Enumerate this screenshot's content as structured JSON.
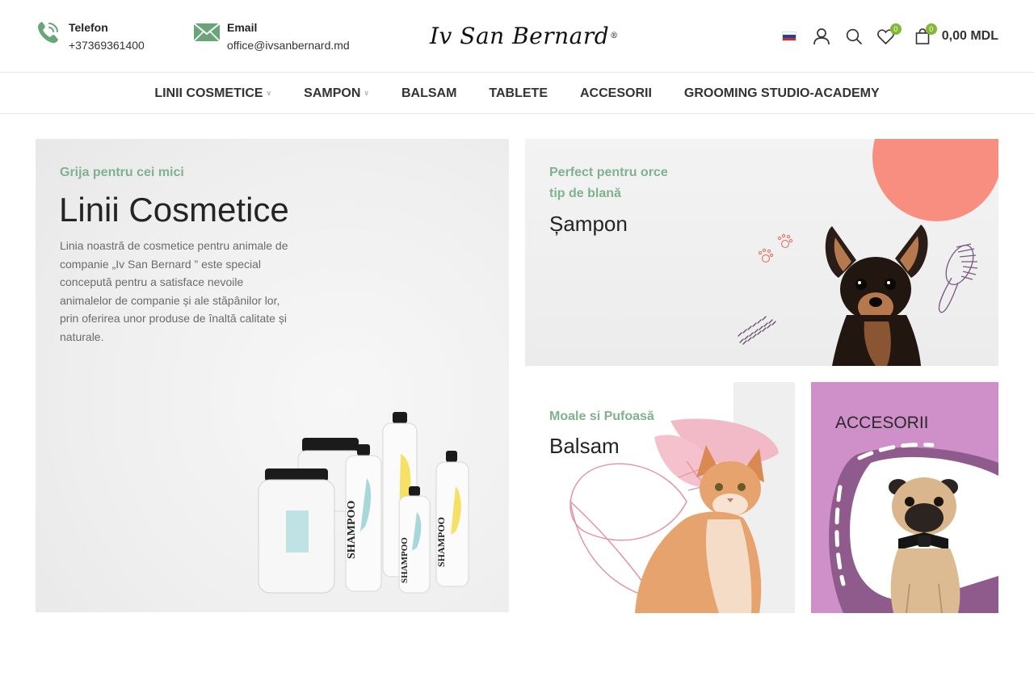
{
  "header": {
    "phone": {
      "label": "Telefon",
      "value": "+37369361400",
      "icon": "phone-icon"
    },
    "email": {
      "label": "Email",
      "value": "office@ivsanbernard.md",
      "icon": "envelope-icon"
    },
    "logo": {
      "text": "Iv San Bernard",
      "mark": "®"
    },
    "language_flag": "ru",
    "wishlist_count": "0",
    "cart_count": "0",
    "cart_total": "0,00 MDL",
    "accent_color": "#83b735"
  },
  "nav": {
    "items": [
      {
        "label": "LINII COSMETICE",
        "has_dropdown": true
      },
      {
        "label": "SAMPON",
        "has_dropdown": true
      },
      {
        "label": "BALSAM",
        "has_dropdown": false
      },
      {
        "label": "TABLETE",
        "has_dropdown": false
      },
      {
        "label": "ACCESORII",
        "has_dropdown": false
      },
      {
        "label": "GROOMING STUDIO-ACADEMY",
        "has_dropdown": false
      }
    ]
  },
  "banners": {
    "cosmetics": {
      "kicker": "Grija pentru cei mici",
      "title": "Linii Cosmetice",
      "description": "Linia noastră de cosmetice pentru animale de companie „Iv San Bernard ” este special concepută pentru a satisface nevoile animalelor de companie și ale stăpânilor lor, prin oferirea unor produse de înaltă calitate și naturale.",
      "bottle_label": "SHAMPOO"
    },
    "shampoo": {
      "kicker_line1": "Perfect pentru orce",
      "kicker_line2": "tip de blană",
      "title": "Șampon"
    },
    "balsam": {
      "kicker": "Moale si Pufoasă",
      "title": "Balsam"
    },
    "accessories": {
      "title": "ACCESORII",
      "bg_color": "#cf8fc8"
    }
  }
}
